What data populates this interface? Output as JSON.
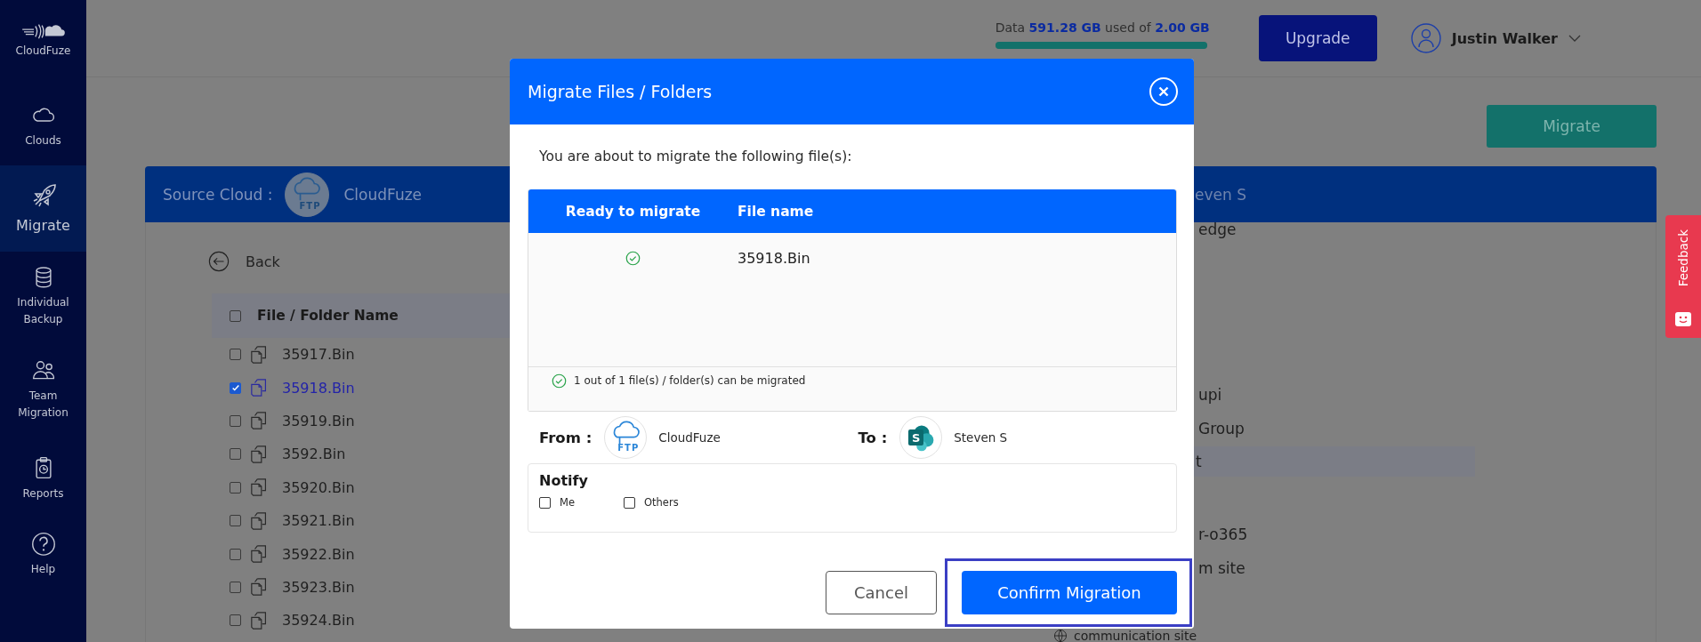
{
  "sidebar": {
    "logo_text": "CloudFuze",
    "items": [
      {
        "label": "Clouds",
        "kind": "cloud",
        "selected": false
      },
      {
        "label": "Migrate",
        "kind": "rocket",
        "selected": true
      },
      {
        "label": "Individual Backup",
        "kind": "database",
        "selected": false
      },
      {
        "label": "Team Migration",
        "kind": "people",
        "selected": false
      },
      {
        "label": "Reports",
        "kind": "clipboard",
        "selected": false
      },
      {
        "label": "Help",
        "kind": "help",
        "selected": false
      }
    ]
  },
  "header": {
    "storage": {
      "text": "Data **591.28 GB** used of **2.00 GB**",
      "level": 1
    },
    "upgrade_button": "Upgrade",
    "user": {
      "name": "Justin Walker"
    }
  },
  "migrate_button": "Migrate",
  "source": {
    "label": "Source Cloud :",
    "logo_text": "FTP",
    "cloud_name": "CloudFuze",
    "back": "Back",
    "all_checked": false,
    "column": "File / Folder Name",
    "files": [
      {
        "name": "35917.Bin",
        "checked": false
      },
      {
        "name": "35918.Bin",
        "checked": true
      },
      {
        "name": "35919.Bin",
        "checked": false
      },
      {
        "name": "3592.Bin",
        "checked": false
      },
      {
        "name": "35920.Bin",
        "checked": false
      },
      {
        "name": "35921.Bin",
        "checked": false
      },
      {
        "name": "35922.Bin",
        "checked": false
      },
      {
        "name": "35923.Bin",
        "checked": false
      },
      {
        "name": "35924.Bin",
        "checked": false
      }
    ]
  },
  "destination": {
    "name": "even S",
    "items": [
      {
        "label": "edge",
        "kind": "text",
        "selected": false
      },
      {
        "label": "upi",
        "kind": "text",
        "selected": false
      },
      {
        "label": "Group",
        "kind": "text",
        "selected": false
      },
      {
        "label": "t",
        "kind": "text",
        "selected": true
      },
      {
        "label": "r-o365",
        "kind": "text",
        "selected": false
      },
      {
        "label": "m site",
        "kind": "text",
        "selected": false
      },
      {
        "label": "communication site",
        "kind": "site",
        "selected": false
      }
    ]
  },
  "modal": {
    "title": "Migrate Files / Folders",
    "intro": "You are about to migrate the following file(s):",
    "columns": [
      "Ready to migrate",
      "File name"
    ],
    "rows": [
      {
        "ready": true,
        "file": "35918.Bin"
      }
    ],
    "summary": "1 out of 1 file(s) / folder(s) can be migrated",
    "from_label": "From :",
    "from_logo_text": "FTP",
    "from_name": "CloudFuze",
    "to_label": "To :",
    "to_logo_text": "S",
    "to_name": "Steven S",
    "notify": {
      "title": "Notify",
      "options": [
        {
          "label": "Me",
          "checked": false
        },
        {
          "label": "Others",
          "checked": false
        }
      ]
    },
    "cancel": "Cancel",
    "confirm": "Confirm Migration",
    "confirm_highlighted": true
  },
  "feedback": "Feedback"
}
